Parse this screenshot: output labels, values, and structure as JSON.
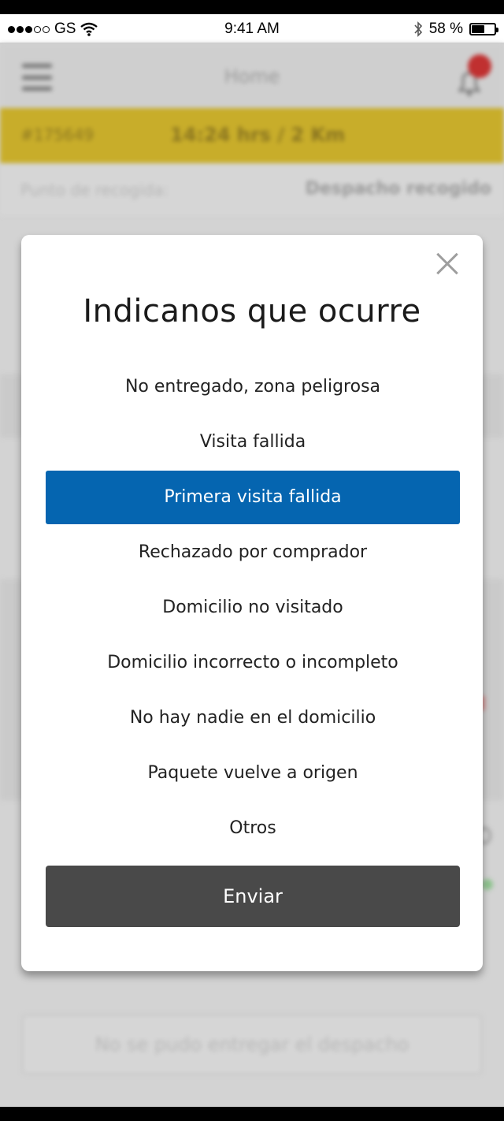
{
  "status_bar": {
    "carrier": "GS",
    "time": "9:41 AM",
    "battery": "58 %",
    "battery_level": 0.58
  },
  "header": {
    "title": "Home"
  },
  "order_bar": {
    "id": "#175649",
    "eta": "14:24 hrs / 2 Km"
  },
  "pickup": {
    "label": "Punto de recogida:",
    "status": "Despacho recogido"
  },
  "background_button": {
    "label": "No se pudo entregar el despacho"
  },
  "modal": {
    "title": "Indicanos que ocurre",
    "options": [
      "No entregado, zona peligrosa",
      "Visita fallida",
      "Primera visita fallida",
      "Rechazado por comprador",
      "Domicilio no visitado",
      "Domicilio incorrecto o incompleto",
      "No hay nadie en el domicilio",
      "Paquete vuelve a origen",
      "Otros"
    ],
    "selected_index": 2,
    "submit_label": "Enviar"
  },
  "colors": {
    "accent": "#0565b0",
    "submit": "#494949",
    "order_bar": "#c8ad2a"
  }
}
